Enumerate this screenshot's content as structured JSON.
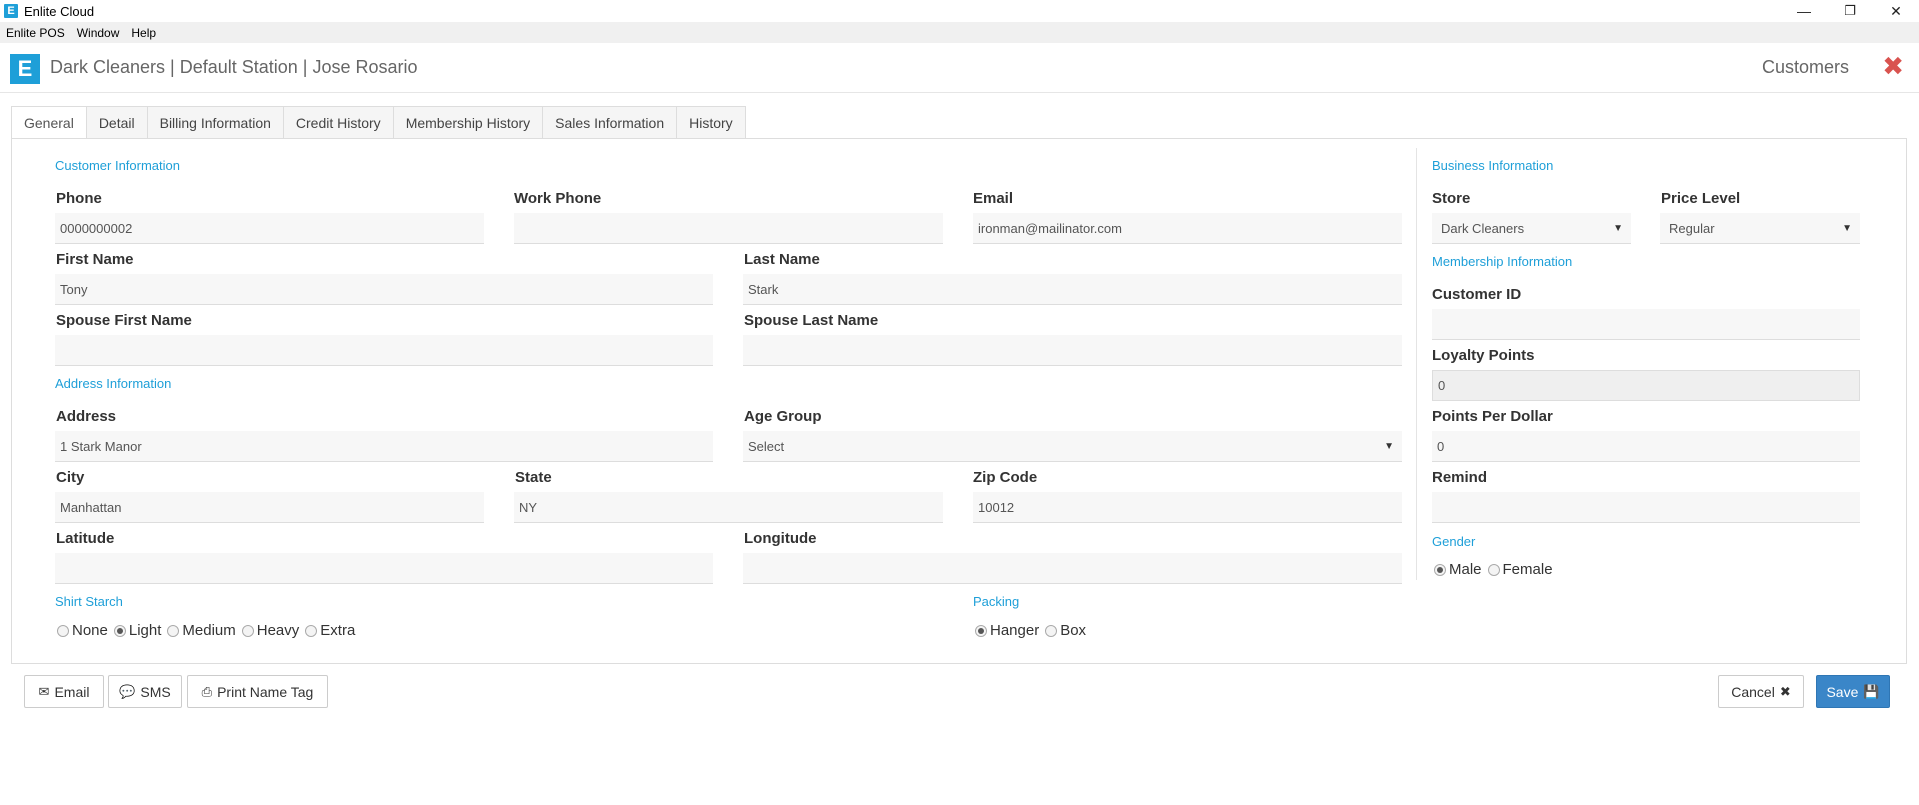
{
  "window": {
    "app_icon": "E",
    "title": "Enlite Cloud",
    "minimize": "—",
    "restore": "❐",
    "close": "✕"
  },
  "menu": [
    "Enlite POS",
    "Window",
    "Help"
  ],
  "header": {
    "logo": "E",
    "title": "Dark Cleaners | Default Station | Jose Rosario",
    "section": "Customers",
    "close": "✖"
  },
  "tabs": [
    "General",
    "Detail",
    "Billing Information",
    "Credit History",
    "Membership History",
    "Sales Information",
    "History"
  ],
  "customer_info": {
    "section": "Customer Information",
    "phone_label": "Phone",
    "phone": "0000000002",
    "work_phone_label": "Work Phone",
    "work_phone": "",
    "email_label": "Email",
    "email": "ironman@mailinator.com",
    "first_name_label": "First Name",
    "first_name": "Tony",
    "last_name_label": "Last Name",
    "last_name": "Stark",
    "spouse_first_label": "Spouse First Name",
    "spouse_first": "",
    "spouse_last_label": "Spouse Last Name",
    "spouse_last": ""
  },
  "address_info": {
    "section": "Address Information",
    "address_label": "Address",
    "address": "1 Stark Manor",
    "age_group_label": "Age Group",
    "age_group": "Select",
    "city_label": "City",
    "city": "Manhattan",
    "state_label": "State",
    "state": "NY",
    "zip_label": "Zip Code",
    "zip": "10012",
    "latitude_label": "Latitude",
    "latitude": "",
    "longitude_label": "Longitude",
    "longitude": ""
  },
  "shirt_starch": {
    "section": "Shirt Starch",
    "options": [
      "None",
      "Light",
      "Medium",
      "Heavy",
      "Extra"
    ],
    "selected": "Light"
  },
  "packing": {
    "section": "Packing",
    "options": [
      "Hanger",
      "Box"
    ],
    "selected": "Hanger"
  },
  "business_info": {
    "section": "Business Information",
    "store_label": "Store",
    "store": "Dark Cleaners",
    "price_level_label": "Price Level",
    "price_level": "Regular"
  },
  "membership_info": {
    "section": "Membership Information",
    "customer_id_label": "Customer ID",
    "customer_id": "",
    "loyalty_label": "Loyalty Points",
    "loyalty": "0",
    "ppd_label": "Points Per Dollar",
    "ppd": "0",
    "remind_label": "Remind",
    "remind": ""
  },
  "gender": {
    "section": "Gender",
    "options": [
      "Male",
      "Female"
    ],
    "selected": "Male"
  },
  "buttons": {
    "email": "Email",
    "sms": "SMS",
    "print": "Print Name Tag",
    "cancel": "Cancel",
    "save": "Save"
  },
  "colors": {
    "accent": "#1e9fd8",
    "primary_button": "#3a86c8",
    "danger": "#d9534f"
  }
}
